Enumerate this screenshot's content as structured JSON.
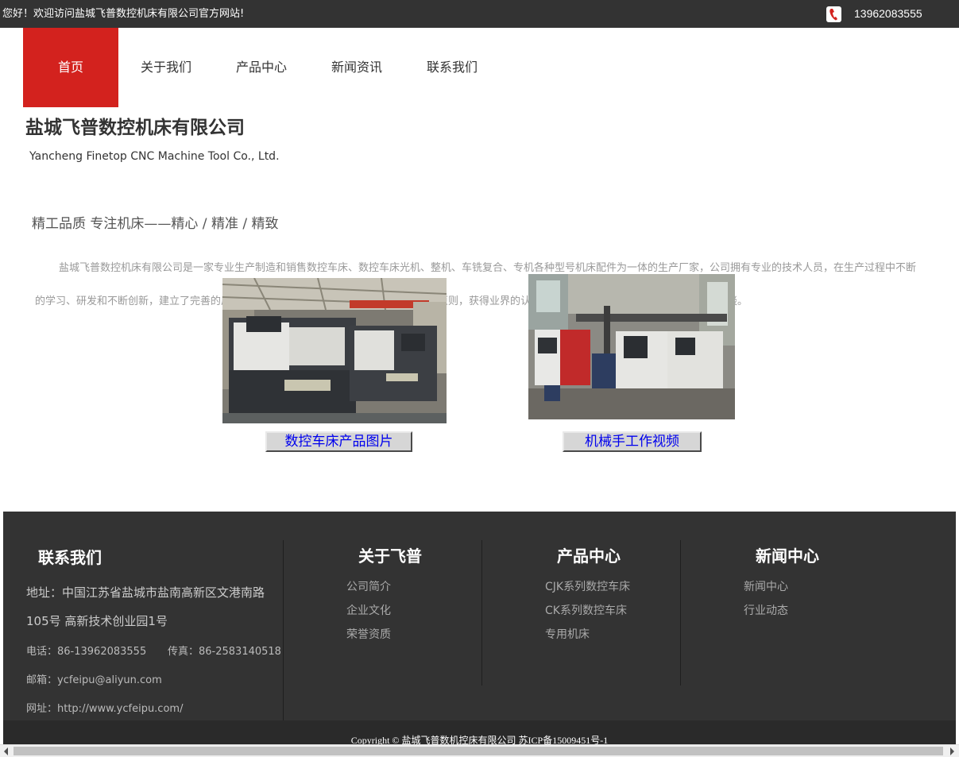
{
  "topbar": {
    "welcome": "您好！欢迎访问盐城飞普数控机床有限公司官方网站!",
    "phone": "13962083555",
    "phone_icon": "phone-icon"
  },
  "nav": {
    "items": [
      {
        "label": "首页",
        "active": true
      },
      {
        "label": "关于我们",
        "active": false
      },
      {
        "label": "产品中心",
        "active": false
      },
      {
        "label": "新闻资讯",
        "active": false
      },
      {
        "label": "联系我们",
        "active": false
      }
    ]
  },
  "company": {
    "name": "盐城飞普数控机床有限公司",
    "name_en": "Yancheng Finetop CNC Machine Tool Co., Ltd.",
    "slogan": "精工品质 专注机床——精心 / 精准 / 精致",
    "intro": "盐城飞普数控机床有限公司是一家专业生产制造和销售数控车床、数控车床光机、整机、车铣复合、专机各种型号机床配件为一体的生产厂家，公司拥有专业的技术人员，在生产过程中不断的学习、研发和不断创新，建立了完善的质量管理体系，我们本着服务至上，诚信至上的原则，获得业界的认可，欢迎各界朋友莅临参观、指导和业务洽谈。"
  },
  "media": {
    "btn_products": "数控车床产品图片",
    "btn_video": "机械手工作视频"
  },
  "footer": {
    "contact": {
      "title": "联系我们",
      "address_line1": "地址：中国江苏省盐城市盐南高新区文港南路",
      "address_line2": "105号 高新技术创业园1号",
      "phone": "电话：86-13962083555",
      "fax": "传真：86-2583140518",
      "email": "邮箱：ycfeipu@aliyun.com",
      "website": "网址：http://www.ycfeipu.com/"
    },
    "about": {
      "title": "关于飞普",
      "links": [
        "公司简介",
        "企业文化",
        "荣誉资质"
      ]
    },
    "products": {
      "title": "产品中心",
      "links": [
        "CJK系列数控车床",
        "CK系列数控车床",
        "专用机床"
      ]
    },
    "news": {
      "title": "新闻中心",
      "links": [
        "新闻中心",
        "行业动态"
      ]
    },
    "copyright": "Copyright © 盐城飞普数机控床有限公司  苏ICP备15009451号-1"
  },
  "colors": {
    "topbar_bg": "#333333",
    "nav_active": "#d3221e",
    "footer_bg": "#333333"
  }
}
